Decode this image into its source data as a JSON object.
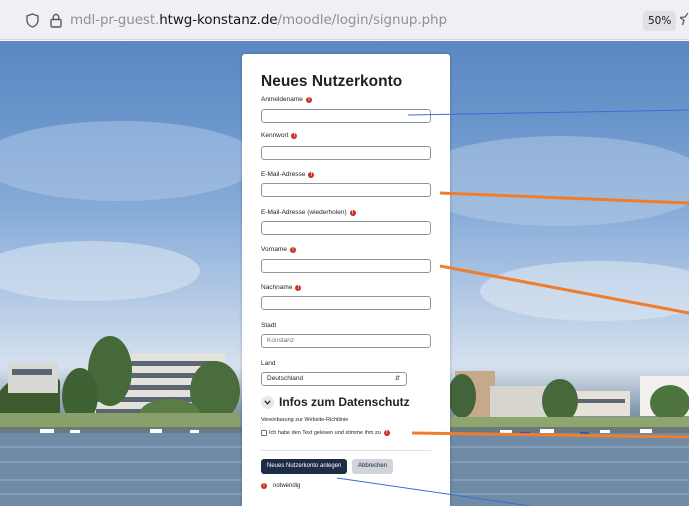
{
  "browser": {
    "url_prefix": "mdl-pr-guest.",
    "url_host": "htwg-konstanz.de",
    "url_path": "/moodle/login/signup.php",
    "zoom": "50%",
    "icons": [
      "shield-icon",
      "lock-icon",
      "star-icon"
    ]
  },
  "form": {
    "title": "Neues Nutzerkonto",
    "fields": [
      {
        "label": "Anmeldename",
        "required": true,
        "value": "",
        "placeholder": ""
      },
      {
        "label": "Kennwort",
        "required": true,
        "value": "",
        "placeholder": ""
      },
      {
        "label": "E-Mail-Adresse",
        "required": true,
        "value": "",
        "placeholder": ""
      },
      {
        "label": "E-Mail-Adresse (wiederholen)",
        "required": true,
        "value": "",
        "placeholder": ""
      },
      {
        "label": "Vorname",
        "required": true,
        "value": "",
        "placeholder": ""
      },
      {
        "label": "Nachname",
        "required": true,
        "value": "",
        "placeholder": ""
      },
      {
        "label": "Stadt",
        "required": false,
        "value": "",
        "placeholder": "Konstanz"
      }
    ],
    "country": {
      "label": "Land",
      "selected": "Deutschland"
    },
    "privacy": {
      "title": "Infos zum Datenschutz",
      "policy_label": "Vereinbarung zur Website-Richtlinie",
      "checkbox_label": "Ich habe den Text gelesen und stimme ihm zu",
      "checked": false
    },
    "buttons": {
      "submit": "Neues Nutzerkonto anlegen",
      "cancel": "Abbrechen"
    },
    "required_note": "notwendig"
  },
  "colors": {
    "required_icon": "#ca3120",
    "primary_button": "#1d2d46",
    "annotation_orange": "#f07d2c",
    "annotation_blue": "#3b6fd4"
  }
}
